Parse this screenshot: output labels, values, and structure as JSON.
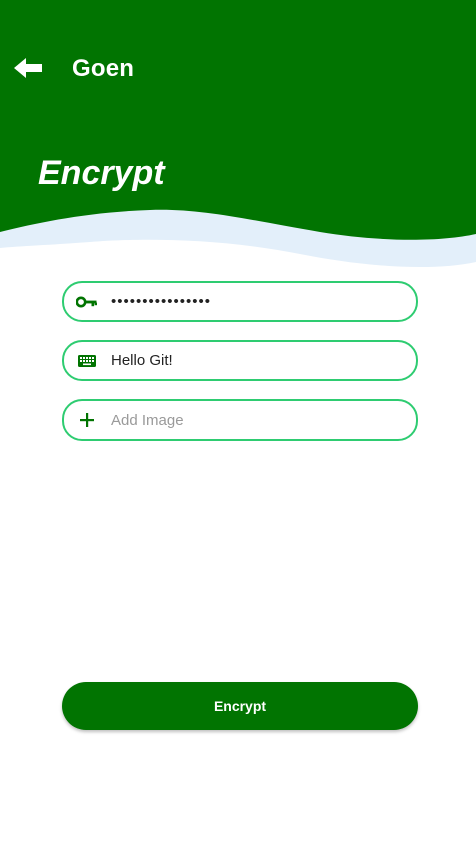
{
  "toolbar": {
    "back_icon": "arrow-left-icon",
    "app_title": "Goen"
  },
  "page": {
    "title": "Encrypt"
  },
  "form": {
    "password": {
      "icon": "key-icon",
      "value": "••••••••••••••••",
      "placeholder": ""
    },
    "message": {
      "icon": "keyboard-icon",
      "value": "Hello Git!",
      "placeholder": ""
    },
    "image": {
      "icon": "plus-icon",
      "label": "Add Image"
    },
    "submit_label": "Encrypt"
  },
  "colors": {
    "header_green": "#017401",
    "wave_light": "#e3effa",
    "field_border": "#2ecc71",
    "icon_green": "#017401"
  }
}
